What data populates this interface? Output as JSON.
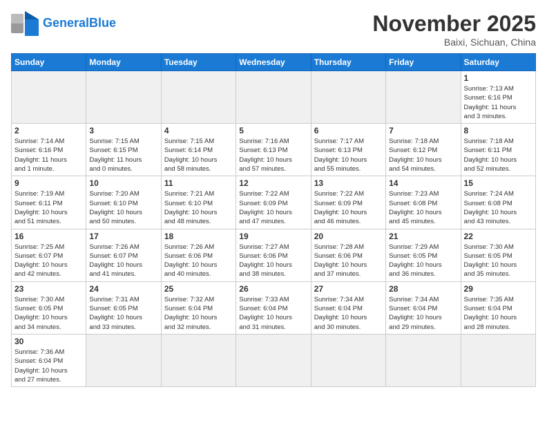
{
  "header": {
    "logo_general": "General",
    "logo_blue": "Blue",
    "month_title": "November 2025",
    "location": "Baixi, Sichuan, China"
  },
  "weekdays": [
    "Sunday",
    "Monday",
    "Tuesday",
    "Wednesday",
    "Thursday",
    "Friday",
    "Saturday"
  ],
  "weeks": [
    [
      {
        "day": "",
        "info": ""
      },
      {
        "day": "",
        "info": ""
      },
      {
        "day": "",
        "info": ""
      },
      {
        "day": "",
        "info": ""
      },
      {
        "day": "",
        "info": ""
      },
      {
        "day": "",
        "info": ""
      },
      {
        "day": "1",
        "info": "Sunrise: 7:13 AM\nSunset: 6:16 PM\nDaylight: 11 hours\nand 3 minutes."
      }
    ],
    [
      {
        "day": "2",
        "info": "Sunrise: 7:14 AM\nSunset: 6:16 PM\nDaylight: 11 hours\nand 1 minute."
      },
      {
        "day": "3",
        "info": "Sunrise: 7:15 AM\nSunset: 6:15 PM\nDaylight: 11 hours\nand 0 minutes."
      },
      {
        "day": "4",
        "info": "Sunrise: 7:15 AM\nSunset: 6:14 PM\nDaylight: 10 hours\nand 58 minutes."
      },
      {
        "day": "5",
        "info": "Sunrise: 7:16 AM\nSunset: 6:13 PM\nDaylight: 10 hours\nand 57 minutes."
      },
      {
        "day": "6",
        "info": "Sunrise: 7:17 AM\nSunset: 6:13 PM\nDaylight: 10 hours\nand 55 minutes."
      },
      {
        "day": "7",
        "info": "Sunrise: 7:18 AM\nSunset: 6:12 PM\nDaylight: 10 hours\nand 54 minutes."
      },
      {
        "day": "8",
        "info": "Sunrise: 7:18 AM\nSunset: 6:11 PM\nDaylight: 10 hours\nand 52 minutes."
      }
    ],
    [
      {
        "day": "9",
        "info": "Sunrise: 7:19 AM\nSunset: 6:11 PM\nDaylight: 10 hours\nand 51 minutes."
      },
      {
        "day": "10",
        "info": "Sunrise: 7:20 AM\nSunset: 6:10 PM\nDaylight: 10 hours\nand 50 minutes."
      },
      {
        "day": "11",
        "info": "Sunrise: 7:21 AM\nSunset: 6:10 PM\nDaylight: 10 hours\nand 48 minutes."
      },
      {
        "day": "12",
        "info": "Sunrise: 7:22 AM\nSunset: 6:09 PM\nDaylight: 10 hours\nand 47 minutes."
      },
      {
        "day": "13",
        "info": "Sunrise: 7:22 AM\nSunset: 6:09 PM\nDaylight: 10 hours\nand 46 minutes."
      },
      {
        "day": "14",
        "info": "Sunrise: 7:23 AM\nSunset: 6:08 PM\nDaylight: 10 hours\nand 45 minutes."
      },
      {
        "day": "15",
        "info": "Sunrise: 7:24 AM\nSunset: 6:08 PM\nDaylight: 10 hours\nand 43 minutes."
      }
    ],
    [
      {
        "day": "16",
        "info": "Sunrise: 7:25 AM\nSunset: 6:07 PM\nDaylight: 10 hours\nand 42 minutes."
      },
      {
        "day": "17",
        "info": "Sunrise: 7:26 AM\nSunset: 6:07 PM\nDaylight: 10 hours\nand 41 minutes."
      },
      {
        "day": "18",
        "info": "Sunrise: 7:26 AM\nSunset: 6:06 PM\nDaylight: 10 hours\nand 40 minutes."
      },
      {
        "day": "19",
        "info": "Sunrise: 7:27 AM\nSunset: 6:06 PM\nDaylight: 10 hours\nand 38 minutes."
      },
      {
        "day": "20",
        "info": "Sunrise: 7:28 AM\nSunset: 6:06 PM\nDaylight: 10 hours\nand 37 minutes."
      },
      {
        "day": "21",
        "info": "Sunrise: 7:29 AM\nSunset: 6:05 PM\nDaylight: 10 hours\nand 36 minutes."
      },
      {
        "day": "22",
        "info": "Sunrise: 7:30 AM\nSunset: 6:05 PM\nDaylight: 10 hours\nand 35 minutes."
      }
    ],
    [
      {
        "day": "23",
        "info": "Sunrise: 7:30 AM\nSunset: 6:05 PM\nDaylight: 10 hours\nand 34 minutes."
      },
      {
        "day": "24",
        "info": "Sunrise: 7:31 AM\nSunset: 6:05 PM\nDaylight: 10 hours\nand 33 minutes."
      },
      {
        "day": "25",
        "info": "Sunrise: 7:32 AM\nSunset: 6:04 PM\nDaylight: 10 hours\nand 32 minutes."
      },
      {
        "day": "26",
        "info": "Sunrise: 7:33 AM\nSunset: 6:04 PM\nDaylight: 10 hours\nand 31 minutes."
      },
      {
        "day": "27",
        "info": "Sunrise: 7:34 AM\nSunset: 6:04 PM\nDaylight: 10 hours\nand 30 minutes."
      },
      {
        "day": "28",
        "info": "Sunrise: 7:34 AM\nSunset: 6:04 PM\nDaylight: 10 hours\nand 29 minutes."
      },
      {
        "day": "29",
        "info": "Sunrise: 7:35 AM\nSunset: 6:04 PM\nDaylight: 10 hours\nand 28 minutes."
      }
    ],
    [
      {
        "day": "30",
        "info": "Sunrise: 7:36 AM\nSunset: 6:04 PM\nDaylight: 10 hours\nand 27 minutes."
      },
      {
        "day": "",
        "info": ""
      },
      {
        "day": "",
        "info": ""
      },
      {
        "day": "",
        "info": ""
      },
      {
        "day": "",
        "info": ""
      },
      {
        "day": "",
        "info": ""
      },
      {
        "day": "",
        "info": ""
      }
    ]
  ]
}
